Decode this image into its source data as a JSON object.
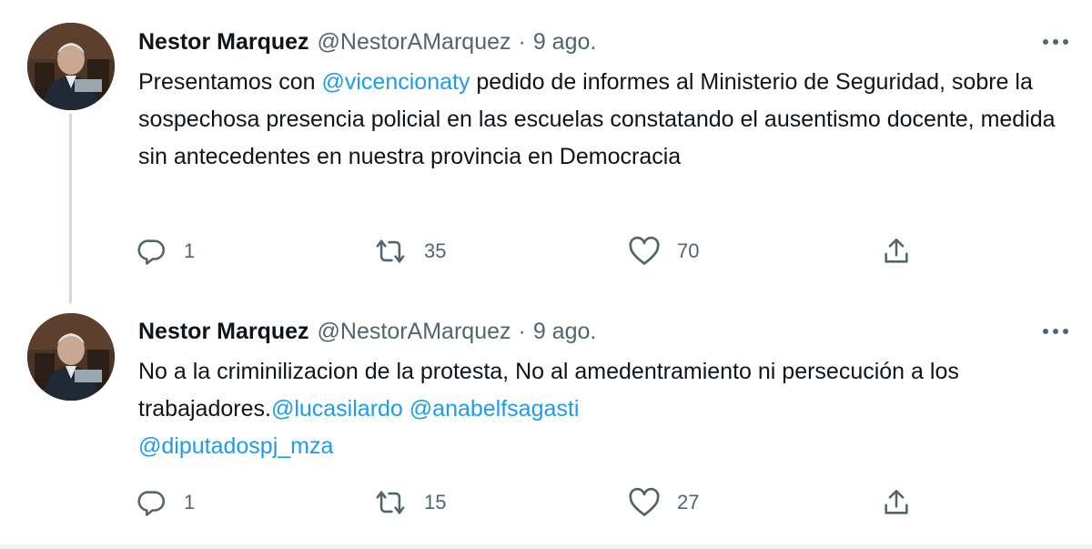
{
  "tweets": [
    {
      "author": {
        "name": "Nestor Marquez",
        "handle": "@NestorAMarquez",
        "separator": "·",
        "time": "9 ago."
      },
      "text": {
        "part1": "Presentamos con ",
        "mention1": "@vicencionaty",
        "part2": " pedido de informes al Ministerio de Seguridad, sobre la sospechosa  presencia policial en las escuelas constatando el ausentismo docente, medida sin antecedentes en nuestra provincia en Democracia"
      },
      "stats": {
        "replies": "1",
        "retweets": "35",
        "likes": "70"
      }
    },
    {
      "author": {
        "name": "Nestor Marquez",
        "handle": "@NestorAMarquez",
        "separator": "·",
        "time": "9 ago."
      },
      "text": {
        "part1": "No a la criminilizacion de la protesta, No al amedentramiento ni persecución a los trabajadores.",
        "mention1": "@lucasilardo",
        "mention2": "@anabelfsagasti",
        "mention3": "@diputadospj_mza"
      },
      "stats": {
        "replies": "1",
        "retweets": "15",
        "likes": "27"
      }
    }
  ],
  "icons": {
    "reply": "reply-icon",
    "retweet": "retweet-icon",
    "like": "heart-icon",
    "share": "share-icon",
    "more": "more-options-icon"
  },
  "colors": {
    "text": "#0f1419",
    "secondary": "#536471",
    "link": "#1d9bf0",
    "thread_line": "#cfd9de"
  }
}
